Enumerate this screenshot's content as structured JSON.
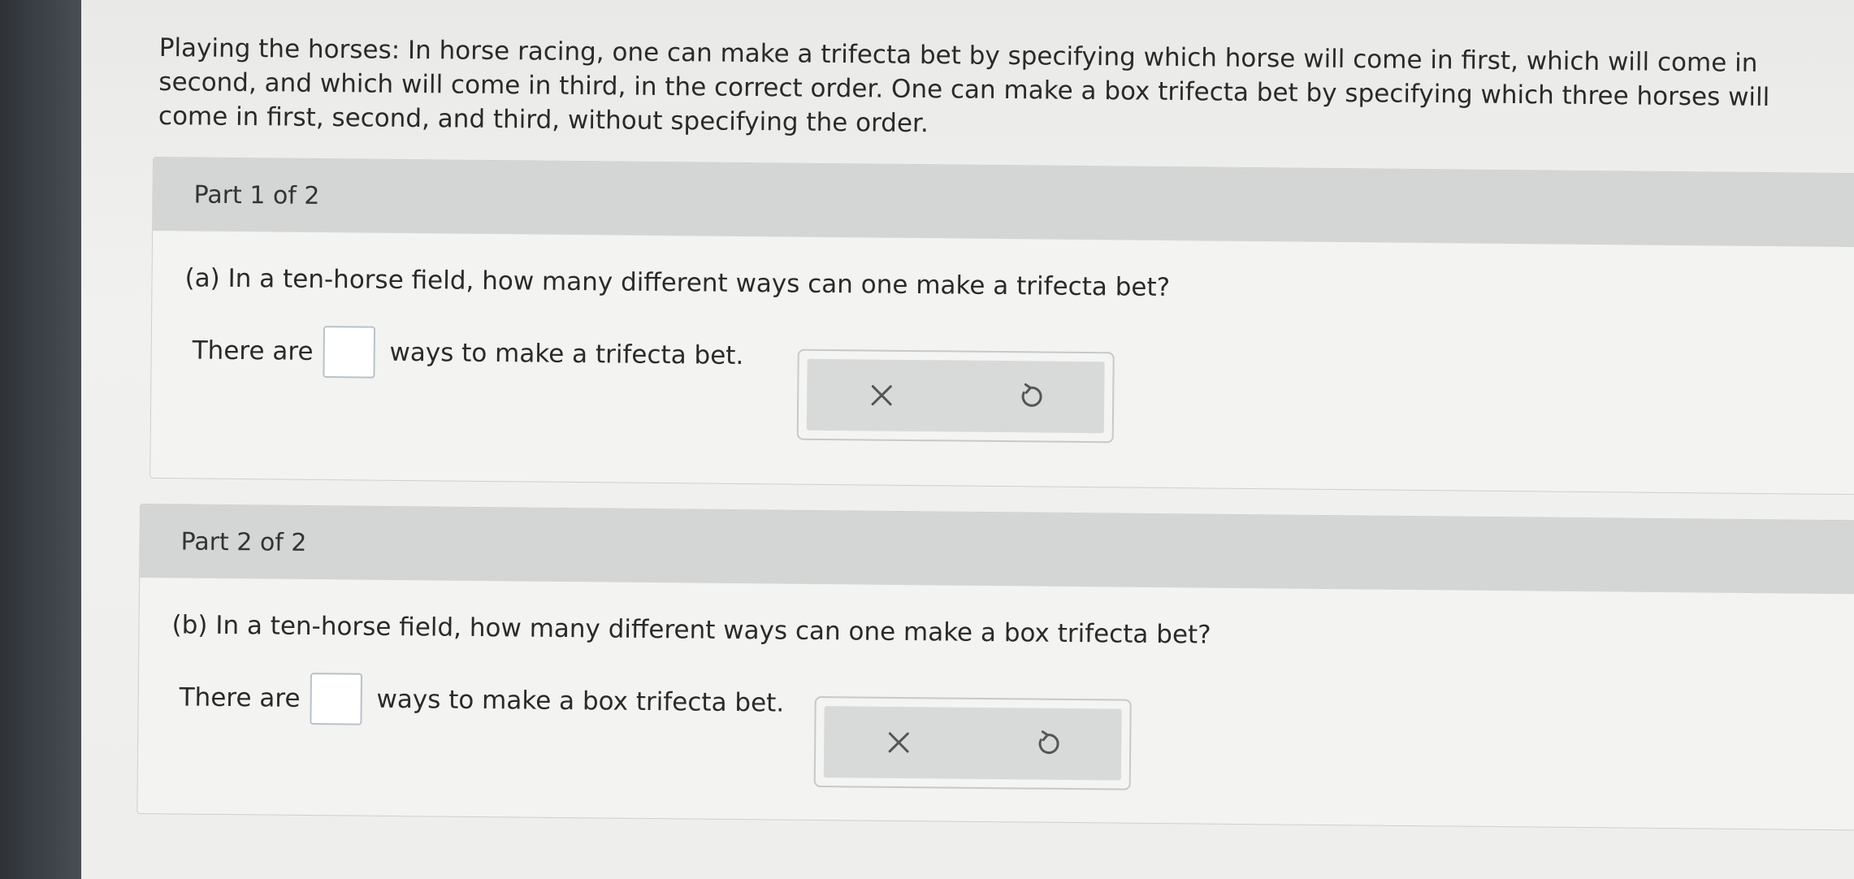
{
  "intro": {
    "text": "Playing the horses: In horse racing, one can make a trifecta bet by specifying which horse will come in first, which will come in second, and which will come in third, in the correct order. One can make a box trifecta bet by specifying which three horses will come in first, second, and third, without specifying the order."
  },
  "parts": [
    {
      "header": "Part 1 of 2",
      "question": "(a) In a ten-horse field, how many different ways can one make a trifecta bet?",
      "answer_prefix": "There are",
      "answer_value": "",
      "answer_suffix": "ways to make a trifecta bet.",
      "clear_icon": "close-icon",
      "reset_icon": "undo-icon"
    },
    {
      "header": "Part 2 of 2",
      "question": "(b) In a ten-horse field, how many different ways can one make a box trifecta bet?",
      "answer_prefix": "There are",
      "answer_value": "",
      "answer_suffix": "ways to make a box trifecta bet.",
      "clear_icon": "close-icon",
      "reset_icon": "undo-icon"
    }
  ]
}
